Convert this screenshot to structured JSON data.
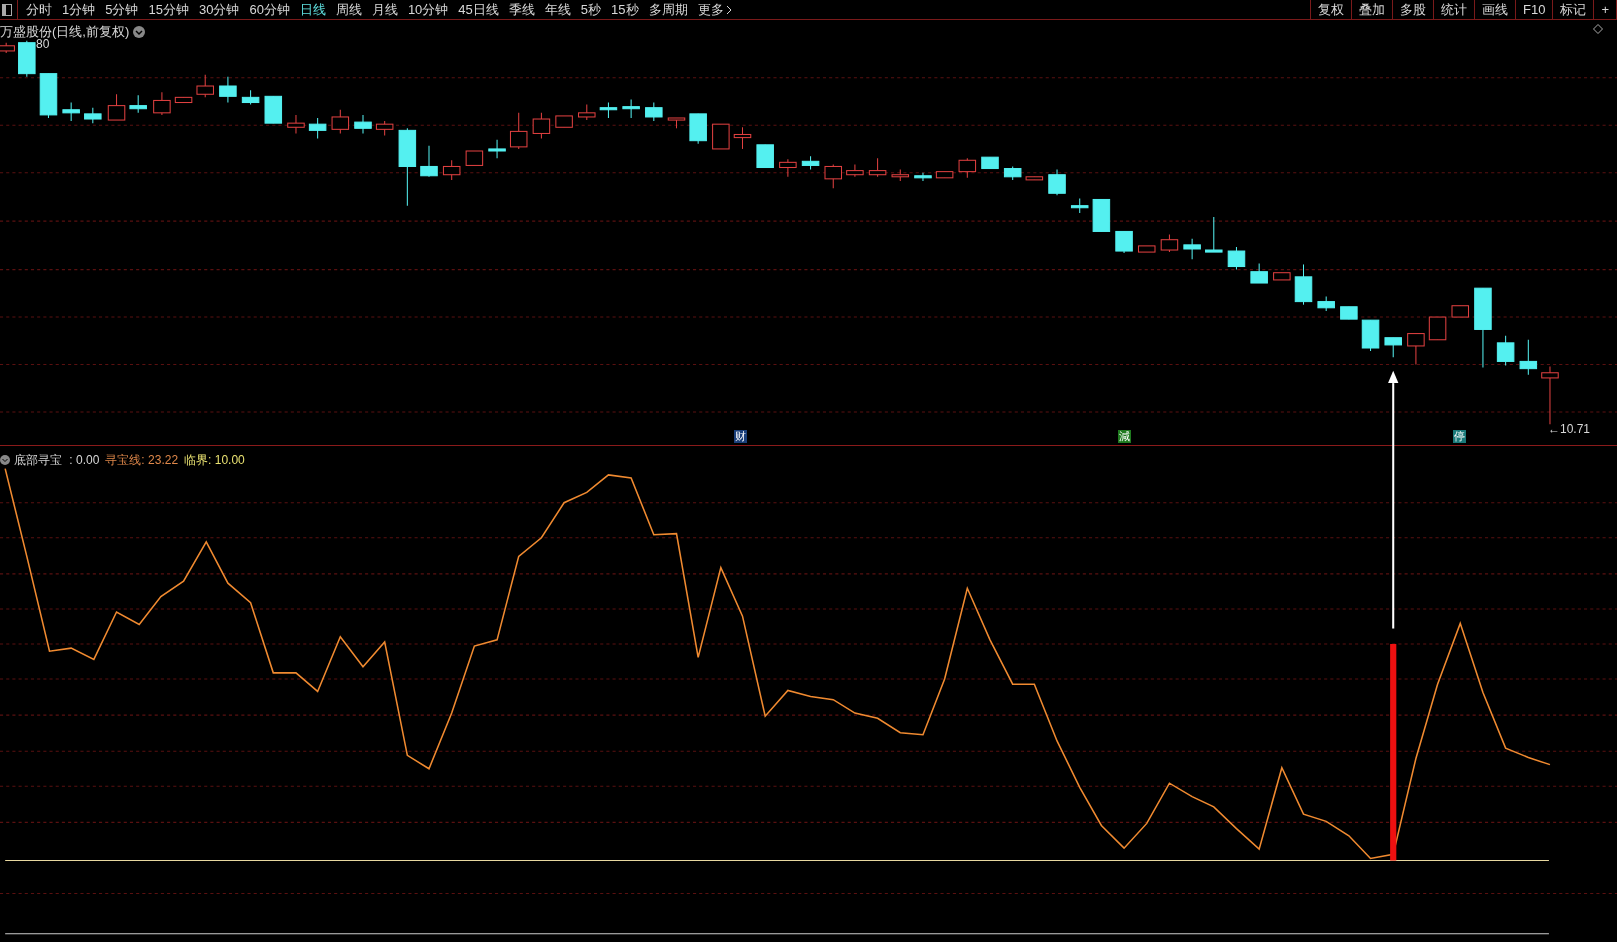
{
  "toolbar": {
    "tabs": [
      {
        "label": "分时",
        "selected": false
      },
      {
        "label": "1分钟",
        "selected": false
      },
      {
        "label": "5分钟",
        "selected": false
      },
      {
        "label": "15分钟",
        "selected": false
      },
      {
        "label": "30分钟",
        "selected": false
      },
      {
        "label": "60分钟",
        "selected": false
      },
      {
        "label": "日线",
        "selected": true
      },
      {
        "label": "周线",
        "selected": false
      },
      {
        "label": "月线",
        "selected": false
      },
      {
        "label": "10分钟",
        "selected": false
      },
      {
        "label": "45日线",
        "selected": false
      },
      {
        "label": "季线",
        "selected": false
      },
      {
        "label": "年线",
        "selected": false
      },
      {
        "label": "5秒",
        "selected": false
      },
      {
        "label": "15秒",
        "selected": false
      },
      {
        "label": "多周期",
        "selected": false
      }
    ],
    "more": "更多",
    "buttons": [
      "复权",
      "叠加",
      "多股",
      "统计",
      "画线",
      "F10",
      "标记",
      "+"
    ]
  },
  "main_chart": {
    "title": "万盛股份(日线,前复权)",
    "top_price": "80",
    "last_price": "←10.71",
    "events": [
      {
        "label": "财",
        "color": "#1a3f7a"
      },
      {
        "label": "減",
        "color": "#1f7a1f"
      },
      {
        "label": "停",
        "color": "#1a7a7a"
      }
    ]
  },
  "indicator": {
    "name": "底部寻宝",
    "value": " : 0.00",
    "lines": [
      {
        "label": "寻宝线: 23.22",
        "color": "#e0884a"
      },
      {
        "label": "临界: 10.00",
        "color": "#e8e070"
      }
    ]
  }
}
